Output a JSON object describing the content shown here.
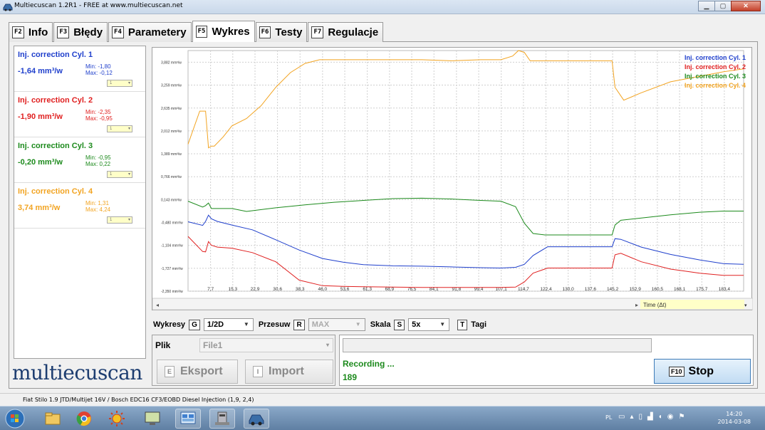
{
  "window": {
    "title": "Multiecuscan 1.2R1 - FREE at www.multiecuscan.net",
    "minimize": "▁",
    "maximize": "▢",
    "close": "✕"
  },
  "tabs": [
    {
      "key": "F2",
      "label": "Info"
    },
    {
      "key": "F3",
      "label": "Błędy"
    },
    {
      "key": "F4",
      "label": "Parametery"
    },
    {
      "key": "F5",
      "label": "Wykres"
    },
    {
      "key": "F6",
      "label": "Testy"
    },
    {
      "key": "F7",
      "label": "Regulacje"
    }
  ],
  "active_tab": "Wykres",
  "channels": [
    {
      "name": "Inj. correction Cyl. 1",
      "value": "-1,64 mm³/w",
      "min": "Min: -1,80",
      "max": "Max: -0,12",
      "scale": "1",
      "color": "#1f3fcc"
    },
    {
      "name": "Inj. correction Cyl. 2",
      "value": "-1,90 mm³/w",
      "min": "Min: -2,35",
      "max": "Max: -0,95",
      "scale": "1",
      "color": "#e02020"
    },
    {
      "name": "Inj. correction Cyl. 3",
      "value": "-0,20 mm³/w",
      "min": "Min: -0,95",
      "max": "Max: 0,22",
      "scale": "1",
      "color": "#1c8a1c"
    },
    {
      "name": "Inj. correction Cyl. 4",
      "value": "3,74 mm³/w",
      "min": "Min: 1,31",
      "max": "Max: 4,24",
      "scale": "1",
      "color": "#f2a422"
    }
  ],
  "logo": "multiecuscan",
  "chart_data": {
    "type": "line",
    "xlabel": "Time (Δt)",
    "ylabel": "",
    "xlim": [
      0,
      190
    ],
    "ylim": [
      -2.35,
      4.2
    ],
    "grid": true,
    "legend_position": "top-right",
    "y_ticks": [
      "3,882 mm³/w",
      "3,259 mm³/w",
      "2,635 mm³/w",
      "2,012 mm³/w",
      "1,389 mm³/w",
      "0,766 mm³/w",
      "0,143 mm³/w",
      "-0,480 mm³/w",
      "-1,104 mm³/w",
      "-1,727 mm³/w",
      "-2,350 mm³/w"
    ],
    "y_tick_values": [
      3.882,
      3.259,
      2.635,
      2.012,
      1.389,
      0.766,
      0.143,
      -0.48,
      -1.104,
      -1.727,
      -2.35
    ],
    "x_ticks": [
      "7,7",
      "15,3",
      "22,9",
      "30,6",
      "38,3",
      "46,0",
      "53,6",
      "61,3",
      "68,9",
      "76,5",
      "84,1",
      "91,8",
      "99,4",
      "107,1",
      "114,7",
      "122,4",
      "130,0",
      "137,6",
      "145,2",
      "152,9",
      "160,5",
      "168,1",
      "175,7",
      "183,4"
    ],
    "x_tick_values": [
      7.7,
      15.3,
      22.9,
      30.6,
      38.3,
      46.0,
      53.6,
      61.3,
      68.9,
      76.5,
      84.1,
      91.8,
      99.4,
      107.1,
      114.7,
      122.4,
      130.0,
      137.6,
      145.2,
      152.9,
      160.5,
      168.1,
      175.7,
      183.4
    ],
    "series": [
      {
        "name": "Inj. correction Cyl. 1",
        "color": "#1f3fcc",
        "x": [
          0,
          5,
          6,
          7,
          8,
          10,
          15,
          22,
          30,
          38,
          46,
          53,
          60,
          70,
          80,
          90,
          100,
          107,
          112,
          115,
          118,
          123,
          130,
          138,
          145,
          146,
          148,
          155,
          165,
          175,
          183,
          190
        ],
        "y": [
          -0.46,
          -0.56,
          -0.45,
          -0.28,
          -0.38,
          -0.45,
          -0.55,
          -0.68,
          -0.95,
          -1.23,
          -1.46,
          -1.56,
          -1.63,
          -1.66,
          -1.67,
          -1.69,
          -1.71,
          -1.72,
          -1.7,
          -1.62,
          -1.38,
          -1.14,
          -1.14,
          -1.14,
          -1.14,
          -0.92,
          -0.94,
          -1.15,
          -1.35,
          -1.5,
          -1.6,
          -1.62
        ]
      },
      {
        "name": "Inj. correction Cyl. 2",
        "color": "#e02020",
        "x": [
          0,
          5,
          6,
          7,
          8,
          10,
          15,
          22,
          30,
          38,
          46,
          53,
          60,
          70,
          80,
          90,
          100,
          107,
          112,
          115,
          118,
          123,
          130,
          138,
          145,
          146,
          148,
          155,
          165,
          175,
          183,
          190
        ],
        "y": [
          -0.86,
          -1.27,
          -1.28,
          -1.0,
          -1.1,
          -1.15,
          -1.18,
          -1.3,
          -1.55,
          -2.05,
          -2.2,
          -2.22,
          -2.23,
          -2.24,
          -2.25,
          -2.25,
          -2.25,
          -2.25,
          -2.24,
          -2.1,
          -1.86,
          -1.72,
          -1.72,
          -1.72,
          -1.72,
          -1.36,
          -1.32,
          -1.55,
          -1.75,
          -1.86,
          -1.92,
          -1.92
        ]
      },
      {
        "name": "Inj. correction Cyl. 3",
        "color": "#1c8a1c",
        "x": [
          0,
          5,
          6,
          7,
          8,
          10,
          15,
          20,
          30,
          40,
          50,
          60,
          70,
          80,
          90,
          100,
          107,
          112,
          115,
          118,
          122,
          130,
          138,
          145,
          146,
          148,
          155,
          165,
          175,
          183,
          190
        ],
        "y": [
          0.1,
          -0.06,
          -0.02,
          0.05,
          -0.1,
          -0.1,
          -0.1,
          -0.18,
          -0.08,
          0.0,
          0.07,
          0.12,
          0.17,
          0.18,
          0.16,
          0.12,
          0.1,
          -0.05,
          -0.5,
          -0.78,
          -0.82,
          -0.82,
          -0.82,
          -0.82,
          -0.55,
          -0.42,
          -0.36,
          -0.27,
          -0.2,
          -0.17,
          -0.17
        ]
      },
      {
        "name": "Inj. correction Cyl. 4",
        "color": "#f2a422",
        "x": [
          0,
          4,
          6,
          7,
          8,
          9,
          12,
          15,
          20,
          25,
          30,
          35,
          40,
          45,
          50,
          60,
          70,
          80,
          90,
          100,
          107,
          111,
          113,
          115,
          117,
          122,
          130,
          138,
          145,
          146,
          149,
          155,
          165,
          175,
          183,
          190
        ],
        "y": [
          1.65,
          2.55,
          2.55,
          1.55,
          1.6,
          1.6,
          1.85,
          2.15,
          2.35,
          2.7,
          3.2,
          3.6,
          3.85,
          3.95,
          3.95,
          3.95,
          3.95,
          3.95,
          3.92,
          3.95,
          3.95,
          4.05,
          4.2,
          4.15,
          3.92,
          3.92,
          3.92,
          3.92,
          3.92,
          3.2,
          2.85,
          3.05,
          3.35,
          3.5,
          3.62,
          3.7
        ]
      }
    ]
  },
  "controls": {
    "wykresy_label": "Wykresy",
    "wykresy_key": "G",
    "wykresy_value": "1/2D",
    "przesuw_label": "Przesuw",
    "przesuw_key": "R",
    "przesuw_value": "MAX",
    "skala_label": "Skala",
    "skala_key": "S",
    "skala_value": "5x",
    "tagi_key": "T",
    "tagi_label": "Tagi"
  },
  "file_panel": {
    "label": "Plik",
    "file_value": "File1",
    "export_key": "E",
    "export_label": "Eksport",
    "import_key": "I",
    "import_label": "Import"
  },
  "recording": {
    "status": "Recording ...",
    "count": "189",
    "stop_key": "F10",
    "stop_label": "Stop"
  },
  "status_bar": "Fiat Stilo 1.9 JTD/Multijet 16V / Bosch EDC16 CF3/EOBD Diesel Injection (1,9, 2,4)",
  "taskbar": {
    "lang": "PL",
    "time": "14:20",
    "date": "2014-03-08"
  },
  "colors": {
    "accent": "#1d3d70",
    "grid": "#cfcfcf",
    "axis_box": "#ffffc8"
  }
}
